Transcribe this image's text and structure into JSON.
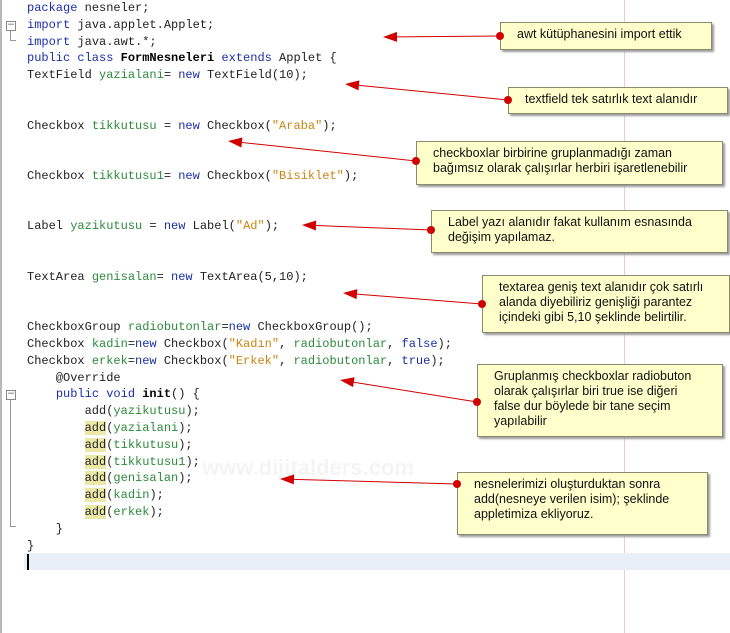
{
  "colors": {
    "keyword": "#1a2ea8",
    "field": "#2c8a3c",
    "string": "#c98510",
    "note_bg": "#ffffcc",
    "arrow": "#d10000"
  },
  "watermark": "www.dijitalders.com",
  "code": [
    [
      [
        "package",
        "kw"
      ],
      [
        " nesneler;",
        ""
      ]
    ],
    [
      [
        "import",
        "kw"
      ],
      [
        " java.applet.Applet;",
        ""
      ]
    ],
    [
      [
        "import",
        "kw"
      ],
      [
        " java.awt.*;",
        ""
      ]
    ],
    [
      [
        "public class ",
        "kw"
      ],
      [
        "FormNesneleri",
        "b"
      ],
      [
        " extends",
        "kw"
      ],
      [
        " Applet {",
        ""
      ]
    ],
    [
      [
        "TextField ",
        ""
      ],
      [
        "yazialani",
        "fd"
      ],
      [
        "= ",
        ""
      ],
      [
        "new",
        "kw"
      ],
      [
        " TextField(10);",
        ""
      ]
    ],
    [],
    [],
    [
      [
        "Checkbox ",
        ""
      ],
      [
        "tikkutusu",
        "fd"
      ],
      [
        " = ",
        ""
      ],
      [
        "new",
        "kw"
      ],
      [
        " Checkbox(",
        ""
      ],
      [
        "\"Araba\"",
        "st"
      ],
      [
        ");",
        ""
      ]
    ],
    [],
    [],
    [
      [
        "Checkbox ",
        ""
      ],
      [
        "tikkutusu1",
        "fd"
      ],
      [
        "= ",
        ""
      ],
      [
        "new",
        "kw"
      ],
      [
        " Checkbox(",
        ""
      ],
      [
        "\"Bisiklet\"",
        "st"
      ],
      [
        ");",
        ""
      ]
    ],
    [],
    [],
    [
      [
        "Label ",
        ""
      ],
      [
        "yazikutusu",
        "fd"
      ],
      [
        " = ",
        ""
      ],
      [
        "new",
        "kw"
      ],
      [
        " Label(",
        ""
      ],
      [
        "\"Ad\"",
        "st"
      ],
      [
        ");",
        ""
      ]
    ],
    [],
    [],
    [
      [
        "TextArea ",
        ""
      ],
      [
        "genisalan",
        "fd"
      ],
      [
        "= ",
        ""
      ],
      [
        "new",
        "kw"
      ],
      [
        " TextArea(5,10);",
        ""
      ]
    ],
    [],
    [],
    [
      [
        "CheckboxGroup ",
        ""
      ],
      [
        "radiobutonlar",
        "fd"
      ],
      [
        "=",
        ""
      ],
      [
        "new",
        "kw"
      ],
      [
        " CheckboxGroup();",
        ""
      ]
    ],
    [
      [
        "Checkbox ",
        ""
      ],
      [
        "kadin",
        "fd"
      ],
      [
        "=",
        ""
      ],
      [
        "new",
        "kw"
      ],
      [
        " Checkbox(",
        ""
      ],
      [
        "\"Kadın\"",
        "st"
      ],
      [
        ", ",
        ""
      ],
      [
        "radiobutonlar",
        "fd"
      ],
      [
        ", ",
        ""
      ],
      [
        "false",
        "kw"
      ],
      [
        ");",
        ""
      ]
    ],
    [
      [
        "Checkbox ",
        ""
      ],
      [
        "erkek",
        "fd"
      ],
      [
        "=",
        ""
      ],
      [
        "new",
        "kw"
      ],
      [
        " Checkbox(",
        ""
      ],
      [
        "\"Erkek\"",
        "st"
      ],
      [
        ", ",
        ""
      ],
      [
        "radiobutonlar",
        "fd"
      ],
      [
        ", ",
        ""
      ],
      [
        "true",
        "kw"
      ],
      [
        ");",
        ""
      ]
    ],
    [
      [
        "    @Override",
        ""
      ]
    ],
    [
      [
        "    ",
        ""
      ],
      [
        "public void ",
        "kw"
      ],
      [
        "init",
        "b"
      ],
      [
        "() {",
        ""
      ]
    ],
    [
      [
        "        add(",
        ""
      ],
      [
        "yazikutusu",
        "fd"
      ],
      [
        ");",
        ""
      ]
    ],
    [
      [
        "        ",
        ""
      ],
      [
        "add",
        "hl"
      ],
      [
        "(",
        ""
      ],
      [
        "yazialani",
        "fd"
      ],
      [
        ");",
        ""
      ]
    ],
    [
      [
        "        ",
        ""
      ],
      [
        "add",
        "hl"
      ],
      [
        "(",
        ""
      ],
      [
        "tikkutusu",
        "fd"
      ],
      [
        ");",
        ""
      ]
    ],
    [
      [
        "        ",
        ""
      ],
      [
        "add",
        "hl"
      ],
      [
        "(",
        ""
      ],
      [
        "tikkutusu1",
        "fd"
      ],
      [
        ");",
        ""
      ]
    ],
    [
      [
        "        ",
        ""
      ],
      [
        "add",
        "hl"
      ],
      [
        "(",
        ""
      ],
      [
        "genisalan",
        "fd"
      ],
      [
        ");",
        ""
      ]
    ],
    [
      [
        "        ",
        ""
      ],
      [
        "add",
        "hl"
      ],
      [
        "(",
        ""
      ],
      [
        "kadin",
        "fd"
      ],
      [
        ");",
        ""
      ]
    ],
    [
      [
        "        ",
        ""
      ],
      [
        "add",
        "hl"
      ],
      [
        "(",
        ""
      ],
      [
        "erkek",
        "fd"
      ],
      [
        ");",
        ""
      ]
    ],
    [
      [
        "    }",
        ""
      ]
    ],
    [
      [
        "}",
        ""
      ]
    ]
  ],
  "notes": [
    {
      "lines": [
        "awt kütüphanesini import ettik"
      ]
    },
    {
      "lines": [
        "textfield tek satırlık text alanıdır"
      ]
    },
    {
      "lines": [
        "checkboxlar birbirine gruplanmadığı zaman",
        "bağımsız olarak çalışırlar herbiri işaretlenebilir"
      ]
    },
    {
      "lines": [
        "Label yazı alanıdır fakat kullanım esnasında",
        "değişim yapılamaz."
      ]
    },
    {
      "lines": [
        "textarea geniş text alanıdır çok satırlı",
        "alanda diyebiliriz genişliği parantez",
        "içindeki gibi 5,10 şeklinde belirtilir."
      ]
    },
    {
      "lines": [
        "Gruplanmış checkboxlar radiobuton",
        "olarak çalışırlar biri true ise diğeri",
        "false dur böylede bir tane seçim",
        "yapılabilir"
      ]
    },
    {
      "lines": [
        "nesnelerimizi oluşturduktan sonra",
        "add(nesneye verilen isim); şeklinde",
        "appletimiza ekliyoruz."
      ]
    }
  ]
}
